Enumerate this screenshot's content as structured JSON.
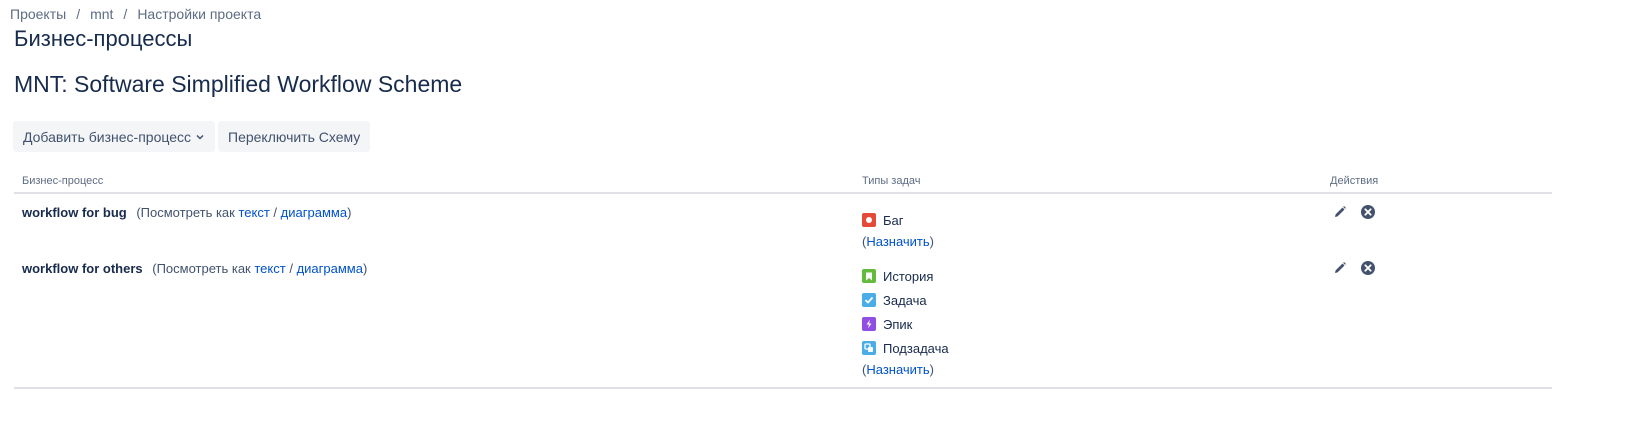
{
  "breadcrumb": {
    "items": [
      "Проекты",
      "mnt",
      "Настройки проекта"
    ],
    "separator": "/"
  },
  "page_title": "Бизнес-процессы",
  "scheme_title": "MNT: Software Simplified Workflow Scheme",
  "toolbar": {
    "add_workflow_label": "Добавить бизнес-процесс",
    "switch_scheme_label": "Переключить Схему"
  },
  "table": {
    "headers": {
      "workflow": "Бизнес-процесс",
      "issue_types": "Типы задач",
      "actions": "Действия"
    },
    "view_as_prefix": "(Посмотреть как",
    "view_text_link": "текст",
    "view_slash": "/",
    "view_diagram_link": "диаграмма",
    "view_suffix": ")",
    "assign_open": "(",
    "assign_link": "Назначить",
    "assign_close": ")",
    "rows": [
      {
        "name": "workflow for bug",
        "issue_types": [
          {
            "label": "Баг",
            "icon": "bug-icon",
            "color": "#e5493a"
          }
        ]
      },
      {
        "name": "workflow for others",
        "issue_types": [
          {
            "label": "История",
            "icon": "story-icon",
            "color": "#63ba3c"
          },
          {
            "label": "Задача",
            "icon": "task-icon",
            "color": "#4bade8"
          },
          {
            "label": "Эпик",
            "icon": "epic-icon",
            "color": "#904ee2"
          },
          {
            "label": "Подзадача",
            "icon": "subtask-icon",
            "color": "#4bade8"
          }
        ]
      }
    ]
  },
  "colors": {
    "link": "#0052cc",
    "text": "#172b4d",
    "muted": "#5e6c84",
    "button_bg": "#f4f5f7",
    "action_icon": "#42526e"
  }
}
